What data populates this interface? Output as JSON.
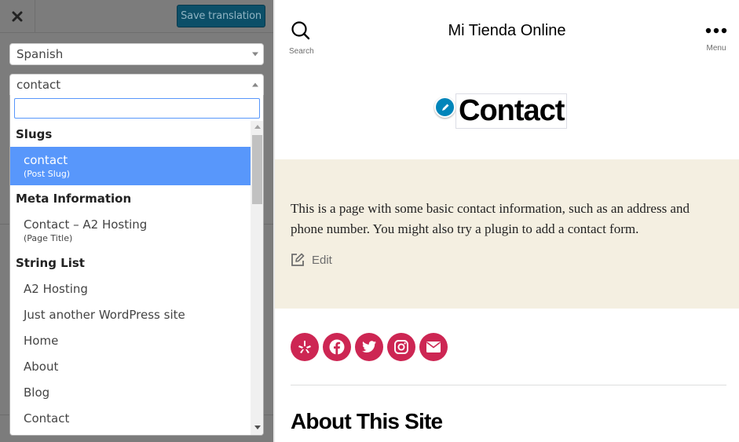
{
  "panel": {
    "close_icon": "close-icon",
    "save_label": "Save translation",
    "language_select": {
      "selected": "Spanish"
    },
    "string_select": {
      "selected": "contact",
      "search_value": "",
      "search_placeholder": ""
    },
    "dropdown": {
      "groups": [
        {
          "label": "Slugs",
          "options": [
            {
              "label": "contact",
              "sublabel": "(Post Slug)",
              "selected": true
            }
          ]
        },
        {
          "label": "Meta Information",
          "options": [
            {
              "label": "Contact – A2 Hosting",
              "sublabel": "(Page Title)",
              "selected": false
            }
          ]
        },
        {
          "label": "String List",
          "options": [
            {
              "label": "A2 Hosting"
            },
            {
              "label": "Just another WordPress site"
            },
            {
              "label": "Home"
            },
            {
              "label": "About"
            },
            {
              "label": "Blog"
            },
            {
              "label": "Contact"
            }
          ]
        }
      ]
    }
  },
  "preview": {
    "search_label": "Search",
    "site_title": "Mi Tienda Online",
    "menu_label": "Menu",
    "page_title": "Contact",
    "content": "This is a page with some basic contact information, such as an address and phone number. You might also try a plugin to add a contact form.",
    "edit_label": "Edit",
    "social_icons": [
      "yelp-icon",
      "facebook-icon",
      "twitter-icon",
      "instagram-icon",
      "mail-icon"
    ],
    "about_heading": "About This Site",
    "colors": {
      "accent": "#cd2653",
      "content_background": "#f4efe1",
      "save_button": "#0c4f68",
      "selected_option": "#5897fb",
      "edit_badge": "#0085ba"
    }
  }
}
